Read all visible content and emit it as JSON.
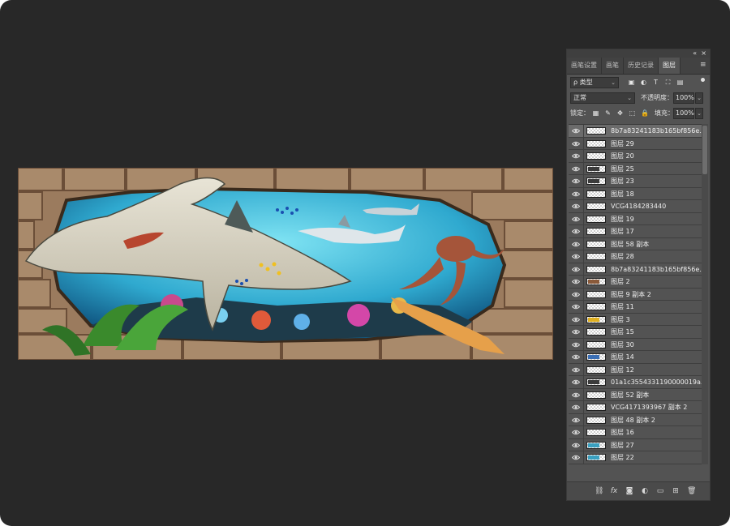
{
  "panel": {
    "tabs": [
      {
        "label": "画笔设置"
      },
      {
        "label": "画笔"
      },
      {
        "label": "历史记录"
      },
      {
        "label": "图层"
      }
    ],
    "filter": {
      "label": "ρ 类型"
    },
    "blend_mode": "正常",
    "opacity_label": "不透明度：",
    "opacity_value": "100%",
    "lock_label": "锁定：",
    "fill_label": "填充：",
    "fill_value": "100%"
  },
  "layers": [
    {
      "name": "8b7a83241183b165bf856e...",
      "selected": true,
      "thumb": "blank"
    },
    {
      "name": "图层 29",
      "thumb": "blank"
    },
    {
      "name": "图层 20",
      "thumb": "blank"
    },
    {
      "name": "图层 25",
      "thumb": "dark"
    },
    {
      "name": "图层 23",
      "thumb": "dark"
    },
    {
      "name": "图层 18",
      "thumb": "blank"
    },
    {
      "name": "VCG4184283440",
      "thumb": "blank"
    },
    {
      "name": "图层 19",
      "thumb": "blank"
    },
    {
      "name": "图层 17",
      "thumb": "blank"
    },
    {
      "name": "图层 58 副本",
      "thumb": "blank"
    },
    {
      "name": "图层 28",
      "thumb": "blank"
    },
    {
      "name": "8b7a83241183b165bf856e...",
      "thumb": "blank"
    },
    {
      "name": "图层 2",
      "thumb": "brown"
    },
    {
      "name": "图层 9 副本 2",
      "thumb": "blank"
    },
    {
      "name": "图层 11",
      "thumb": "blank"
    },
    {
      "name": "图层 3",
      "thumb": "yellow"
    },
    {
      "name": "图层 15",
      "thumb": "blank"
    },
    {
      "name": "图层 30",
      "thumb": "blank"
    },
    {
      "name": "图层 14",
      "thumb": "blue"
    },
    {
      "name": "图层 12",
      "thumb": "blank"
    },
    {
      "name": "01a1c3554331190000019a...",
      "thumb": "dark"
    },
    {
      "name": "图层 52 副本",
      "thumb": "blank"
    },
    {
      "name": "VCG4171393967 副本 2",
      "thumb": "blank"
    },
    {
      "name": "图层 48 副本 2",
      "thumb": "blank"
    },
    {
      "name": "图层 16",
      "thumb": "blank"
    },
    {
      "name": "图层 27",
      "thumb": "teal"
    },
    {
      "name": "图层 22",
      "thumb": "teal"
    }
  ],
  "colors": {
    "app_bg": "#282828",
    "panel_bg": "#535353",
    "selected_row": "#6b6b6b"
  }
}
